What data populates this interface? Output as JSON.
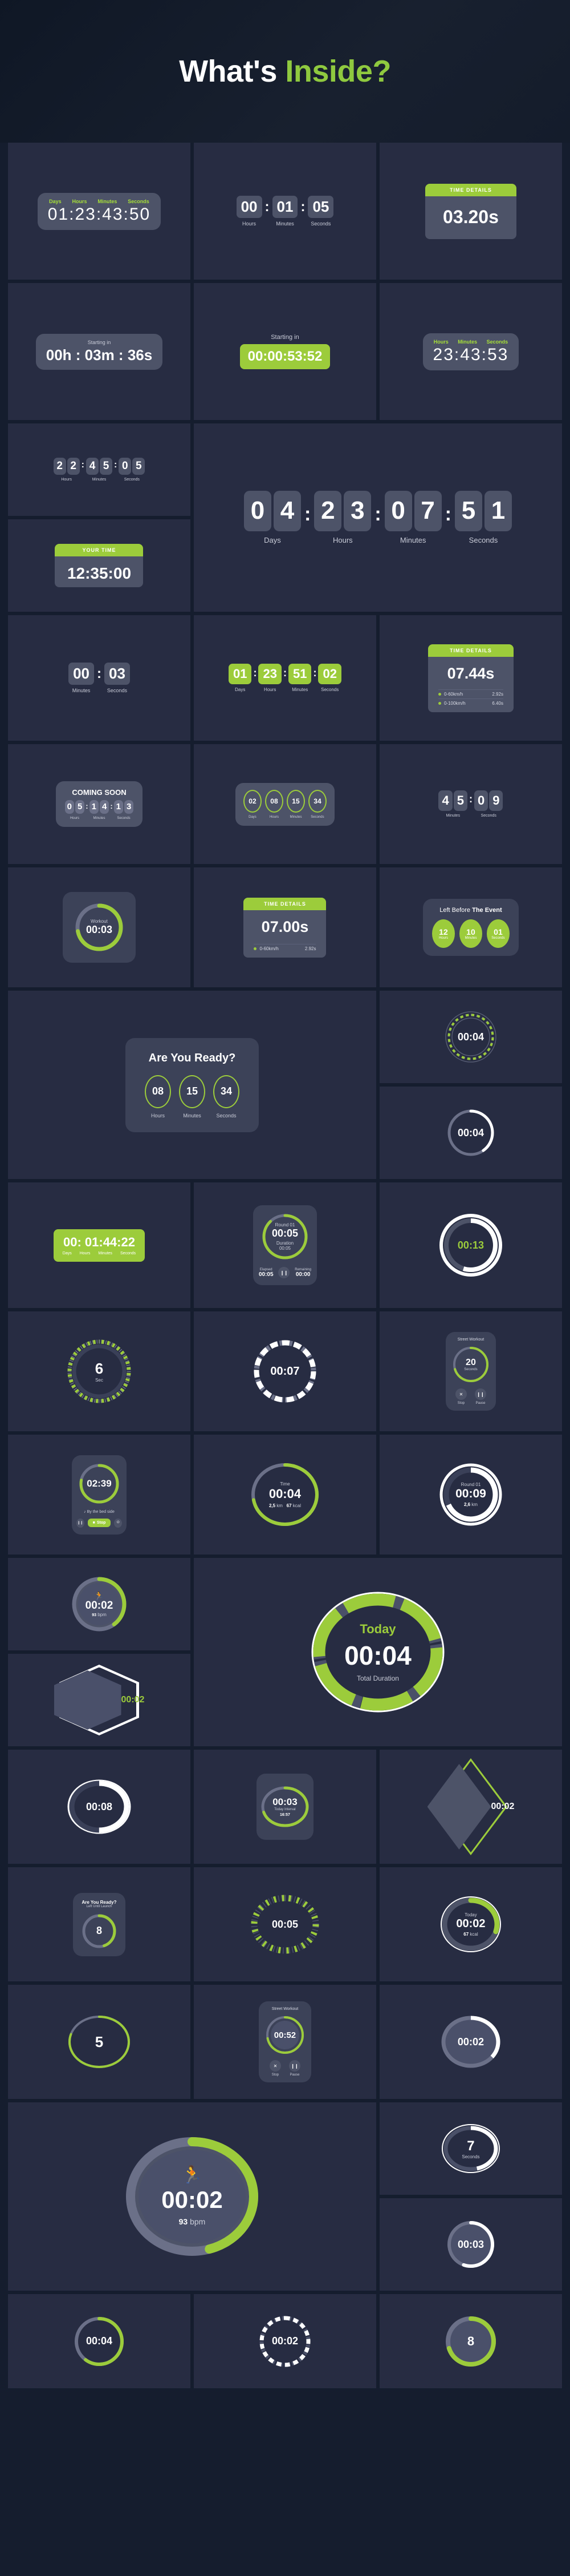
{
  "hero": {
    "title_white": "What's ",
    "title_accent": "Inside?"
  },
  "colors": {
    "accent": "#9ccc3b",
    "bg": "#151d2e",
    "card": "#272c42",
    "panel": "#3c4258",
    "pill": "#4d5368"
  },
  "labels": {
    "days": "Days",
    "hours": "Hours",
    "minutes": "Minutes",
    "seconds": "Seconds",
    "sec": "Sec",
    "starting_in": "Starting in",
    "time_details": "TIME DETAILS",
    "your_time": "YOUR TIME",
    "coming_soon": "COMING SOON",
    "left_before": "Left Before ",
    "the_event": "The Event",
    "are_you_ready": "Are You Ready?",
    "left_until_launch": "Left Until Launch",
    "workout": "Workout",
    "street_workout": "Street Workout",
    "today": "Today",
    "total_duration": "Total Duration",
    "today_interval": "Today Interval",
    "elapsed": "Elapsed",
    "remaining": "Remaining",
    "duration": "Duration",
    "stop": "Stop",
    "pause": "Pause",
    "music": "By the bed side"
  },
  "cards": {
    "r1c1": {
      "values": [
        "01",
        "23",
        "43",
        "50"
      ],
      "labels": [
        "Days",
        "Hours",
        "Minutes",
        "Seconds"
      ]
    },
    "r1c2": {
      "values": [
        "00",
        "01",
        "05"
      ],
      "labels": [
        "Hours",
        "Minutes",
        "Seconds"
      ]
    },
    "r1c3": {
      "header": "TIME DETAILS",
      "value": "03.20s"
    },
    "r2c1": {
      "title": "Starting in",
      "value": "00h : 03m : 36s"
    },
    "r2c2": {
      "title": "Starting in",
      "value": "00:00:53:52"
    },
    "r2c3": {
      "values": [
        "23",
        "43",
        "53"
      ],
      "labels": [
        "Hours",
        "Minutes",
        "Seconds"
      ]
    },
    "r3c1": {
      "digits": [
        "2",
        "2",
        "4",
        "5",
        "0",
        "5"
      ],
      "labels": [
        "Hours",
        "Minutes",
        "Seconds"
      ]
    },
    "r3big": {
      "digits": [
        "0",
        "4",
        "2",
        "3",
        "0",
        "7",
        "5",
        "1"
      ],
      "labels": [
        "Days",
        "Hours",
        "Minutes",
        "Seconds"
      ]
    },
    "r3c1b": {
      "header": "YOUR TIME",
      "value": "12:35:00"
    },
    "r4c1": {
      "values": [
        "00",
        "03"
      ],
      "labels": [
        "Minutes",
        "Seconds"
      ]
    },
    "r4c2": {
      "values": [
        "01",
        "23",
        "51",
        "02"
      ],
      "labels": [
        "Days",
        "Hours",
        "Minutes",
        "Seconds"
      ]
    },
    "r4c3": {
      "header": "TIME DETAILS",
      "value": "07.44s",
      "details": [
        {
          "name": "0-60km/h",
          "time": "2.92s"
        },
        {
          "name": "0-100km/h",
          "time": "6.40s"
        }
      ]
    },
    "r5c1": {
      "title": "COMING SOON",
      "digits": [
        "0",
        "5",
        "1",
        "4",
        "1",
        "3"
      ],
      "labels": [
        "Hours",
        "Minutes",
        "Seconds"
      ]
    },
    "r5c2": {
      "values": [
        "02",
        "08",
        "15",
        "34"
      ],
      "labels": [
        "Days",
        "Hours",
        "Minutes",
        "Seconds"
      ]
    },
    "r5c3": {
      "digits": [
        "4",
        "5",
        "0",
        "9"
      ],
      "labels": [
        "Minutes",
        "Seconds"
      ]
    },
    "r6c1": {
      "label": "Workout",
      "value": "00:03",
      "progress": 72
    },
    "r6c2": {
      "header": "TIME DETAILS",
      "value": "07.00s",
      "details": [
        {
          "name": "0-60km/h",
          "time": "2.92s"
        }
      ]
    },
    "r6c3": {
      "title_a": "Left Before ",
      "title_b": "The Event",
      "values": [
        "12",
        "10",
        "01"
      ],
      "labels": [
        "Hours",
        "Minutes",
        "Seconds"
      ]
    },
    "r7panel": {
      "title": "Are You Ready?",
      "values": [
        "08",
        "15",
        "34"
      ],
      "labels": [
        "Hours",
        "Minutes",
        "Seconds"
      ]
    },
    "r7s1": {
      "value": "00:04",
      "progress": 62
    },
    "r7s2": {
      "value": "00:04",
      "progress": 40
    },
    "r9c1": {
      "value": "00: 01:44:22",
      "labels": [
        "Days",
        "Hours",
        "Minutes",
        "Seconds"
      ]
    },
    "r9c2": {
      "round": "Round 01",
      "value": "00:05",
      "duration_label": "Duration",
      "duration": "00:05",
      "elapsed_label": "Elapsed",
      "elapsed": "00:05",
      "remaining_label": "Remaining",
      "remaining": "00:00",
      "progress": 88
    },
    "r9c3": {
      "value": "00:13",
      "progress": 55
    },
    "r10c1": {
      "value": "6",
      "unit": "Sec",
      "progress": 38
    },
    "r10c2": {
      "value": "00:07",
      "progress": 70
    },
    "r10c3": {
      "title": "Street Workout",
      "value": "20",
      "unit": "Seconds",
      "progress": 70,
      "buttons": [
        {
          "icon": "✕",
          "label": "Stop"
        },
        {
          "icon": "❙❙",
          "label": "Pause"
        }
      ]
    },
    "r11c1": {
      "value": "02:39",
      "music": "By the bed side",
      "progress": 78,
      "buttons": [
        {
          "icon": "❙❙",
          "label": ""
        },
        {
          "icon": "Stop",
          "label": ""
        },
        {
          "icon": "⏻",
          "label": ""
        }
      ]
    },
    "r11c2": {
      "label": "Time",
      "value": "00:04",
      "stat1": "2,5",
      "stat1u": " km",
      "stat2": "67",
      "stat2u": " kcal",
      "progress": 72
    },
    "r11c3": {
      "label": "Round 01",
      "value": "00:09",
      "stat": "2,6",
      "statu": " km",
      "progress": 68
    },
    "r12c1": {
      "value": "00:02",
      "icon": "runner",
      "progress": 40
    },
    "r12big": {
      "title": "Today",
      "value": "00:04",
      "subtitle": "Total Duration",
      "progress": 74
    },
    "r12c1b": {
      "value": "00:02",
      "shape": "hexagon"
    },
    "r13c1": {
      "value": "00:08",
      "progress": 50
    },
    "r13c2": {
      "value": "00:03",
      "label": "Today Interval",
      "sub": "16:57",
      "progress": 72
    },
    "r13c3": {
      "value": "00:02",
      "shape": "diamond"
    },
    "r14c1": {
      "title": "Are You Ready?",
      "subtitle": "Left Until Launch",
      "value": "8",
      "progress": 45
    },
    "r14c2": {
      "value": "00:05",
      "progress": 55
    },
    "r14c3": {
      "label": "Today",
      "value": "00:02",
      "stat": "67",
      "statu": " kcal",
      "progress": 30
    },
    "r15c1": {
      "value": "5",
      "progress": 80
    },
    "r15c2": {
      "title": "Street Workout",
      "value": "00:52",
      "progress": 72,
      "buttons": [
        {
          "icon": "✕",
          "label": "Stop"
        },
        {
          "icon": "❙❙",
          "label": "Pause"
        }
      ]
    },
    "r15c3": {
      "value": "00:02",
      "progress": 35
    },
    "r16big": {
      "value": "00:02",
      "bpm": "93",
      "bpmu": " bpm",
      "icon": "runner",
      "progress": 45
    },
    "r16s1": {
      "value": "7",
      "unit": "Seconds",
      "progress": 45
    },
    "r16s2": {
      "value": "00:03",
      "progress": 55
    },
    "r17c1": {
      "value": "00:04",
      "progress": 60
    },
    "r17c2": {
      "value": "00:02",
      "progress": 65
    },
    "r17c3": {
      "value": "8",
      "progress": 70
    }
  }
}
